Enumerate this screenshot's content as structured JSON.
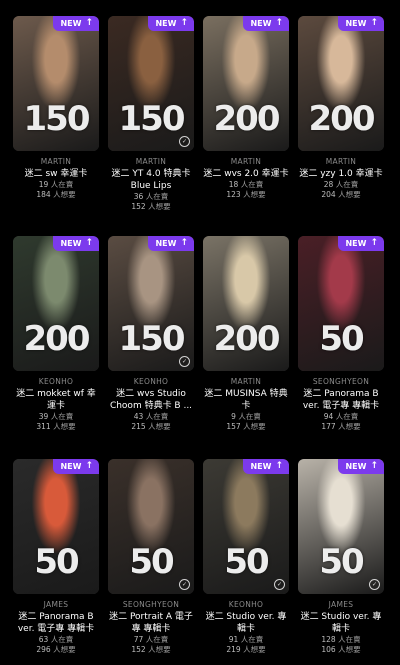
{
  "badge": {
    "label": "NEW",
    "arrow": "↑"
  },
  "want_suffix": "人想要",
  "have_suffix": "人在賣",
  "cards": [
    {
      "price": "150",
      "artist": "MARTIN",
      "title": "迷二 sw 幸運卡",
      "have": "19",
      "want": "184",
      "new": true,
      "checked": false,
      "bg": "#6d5a4c",
      "accent": "#b48c6c"
    },
    {
      "price": "150",
      "artist": "MARTIN",
      "title": "迷二 YT 4.0 特典卡 Blue Lips",
      "have": "36",
      "want": "152",
      "new": true,
      "checked": true,
      "bg": "#3b2a22",
      "accent": "#8a6040"
    },
    {
      "price": "200",
      "artist": "MARTIN",
      "title": "迷二 wvs 2.0 幸運卡",
      "have": "18",
      "want": "123",
      "new": true,
      "checked": false,
      "bg": "#7a6f60",
      "accent": "#c7a98a"
    },
    {
      "price": "200",
      "artist": "MARTIN",
      "title": "迷二 yzy 1.0 幸運卡",
      "have": "28",
      "want": "204",
      "new": true,
      "checked": false,
      "bg": "#5c4a3e",
      "accent": "#d7b89a"
    },
    {
      "price": "200",
      "artist": "KEONHO",
      "title": "迷二 mokket wf 幸運卡",
      "have": "39",
      "want": "311",
      "new": true,
      "checked": false,
      "bg": "#2f3a2e",
      "accent": "#7c8a6e"
    },
    {
      "price": "150",
      "artist": "KEONHO",
      "title": "迷二 wvs Studio Choom 特典卡 B ...",
      "have": "43",
      "want": "215",
      "new": true,
      "checked": true,
      "bg": "#5a4c42",
      "accent": "#a89482"
    },
    {
      "price": "200",
      "artist": "MARTIN",
      "title": "迷二 MUSINSA 特典卡",
      "have": "9",
      "want": "157",
      "new": false,
      "checked": false,
      "bg": "#7a7366",
      "accent": "#d8c8a8"
    },
    {
      "price": "50",
      "artist": "SEONGHYEON",
      "title": "迷二 Panorama B ver. 電子專 專輯卡",
      "have": "94",
      "want": "177",
      "new": true,
      "checked": false,
      "bg": "#4a1f26",
      "accent": "#a33a4a"
    },
    {
      "price": "50",
      "artist": "JAMES",
      "title": "迷二 Panorama B ver. 電子專 專輯卡",
      "have": "63",
      "want": "296",
      "new": true,
      "checked": false,
      "bg": "#2a2a2a",
      "accent": "#d85a3a"
    },
    {
      "price": "50",
      "artist": "SEONGHYEON",
      "title": "迷二 Portrait A 電子專 專輯卡",
      "have": "77",
      "want": "152",
      "new": false,
      "checked": true,
      "bg": "#3a302a",
      "accent": "#8a7262"
    },
    {
      "price": "50",
      "artist": "KEONHO",
      "title": "迷二 Studio ver. 專輯卡",
      "have": "91",
      "want": "219",
      "new": true,
      "checked": true,
      "bg": "#3c3a34",
      "accent": "#8c7a5e"
    },
    {
      "price": "50",
      "artist": "JAMES",
      "title": "迷二 Studio ver. 專輯卡",
      "have": "128",
      "want": "106",
      "new": true,
      "checked": true,
      "bg": "#b8b2a8",
      "accent": "#e6dfd2"
    }
  ]
}
